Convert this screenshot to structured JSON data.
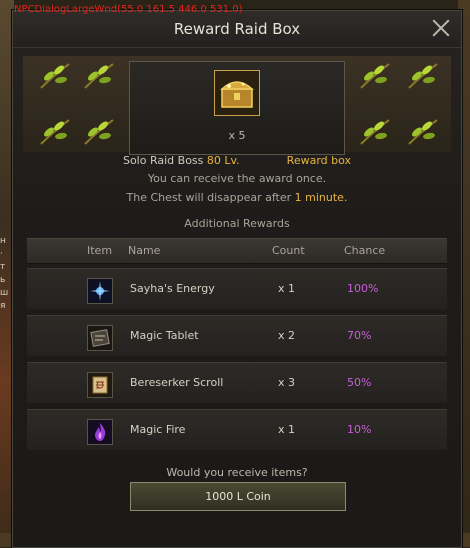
{
  "debug_text": "NPCDialogLargeWnd(55.0 161.5 446.0 531.0)",
  "left_glyphs": [
    "н",
    "·",
    "т",
    "",
    "ь",
    "ш",
    "я"
  ],
  "window": {
    "title": "Reward Raid Box"
  },
  "reward": {
    "quantity": "x 5"
  },
  "info": {
    "boss_label": "Solo Raid Boss",
    "boss_level": "80 Lv.",
    "reward_type": "Reward box",
    "once_text": "You can receive the award once.",
    "disappear_prefix": "The Chest will disappear after",
    "disappear_time": "1 minute."
  },
  "additional": {
    "heading": "Additional Rewards",
    "columns": {
      "item": "Item",
      "name": "Name",
      "count": "Count",
      "chance": "Chance"
    },
    "rows": [
      {
        "name": "Sayha's Energy",
        "count": "x 1",
        "chance": "100%",
        "icon": "energy-icon"
      },
      {
        "name": "Magic Tablet",
        "count": "x 2",
        "chance": "70%",
        "icon": "tablet-icon"
      },
      {
        "name": "Bereserker Scroll",
        "count": "x 3",
        "chance": "50%",
        "icon": "scroll-icon"
      },
      {
        "name": "Magic Fire",
        "count": "x 1",
        "chance": "10%",
        "icon": "fire-icon"
      }
    ]
  },
  "prompt": {
    "question": "Would you receive items?",
    "button_label": "1000 L Coin"
  },
  "colors": {
    "accent": "#e8b340",
    "chance": "#c95fd8",
    "debug": "#e0241c"
  }
}
